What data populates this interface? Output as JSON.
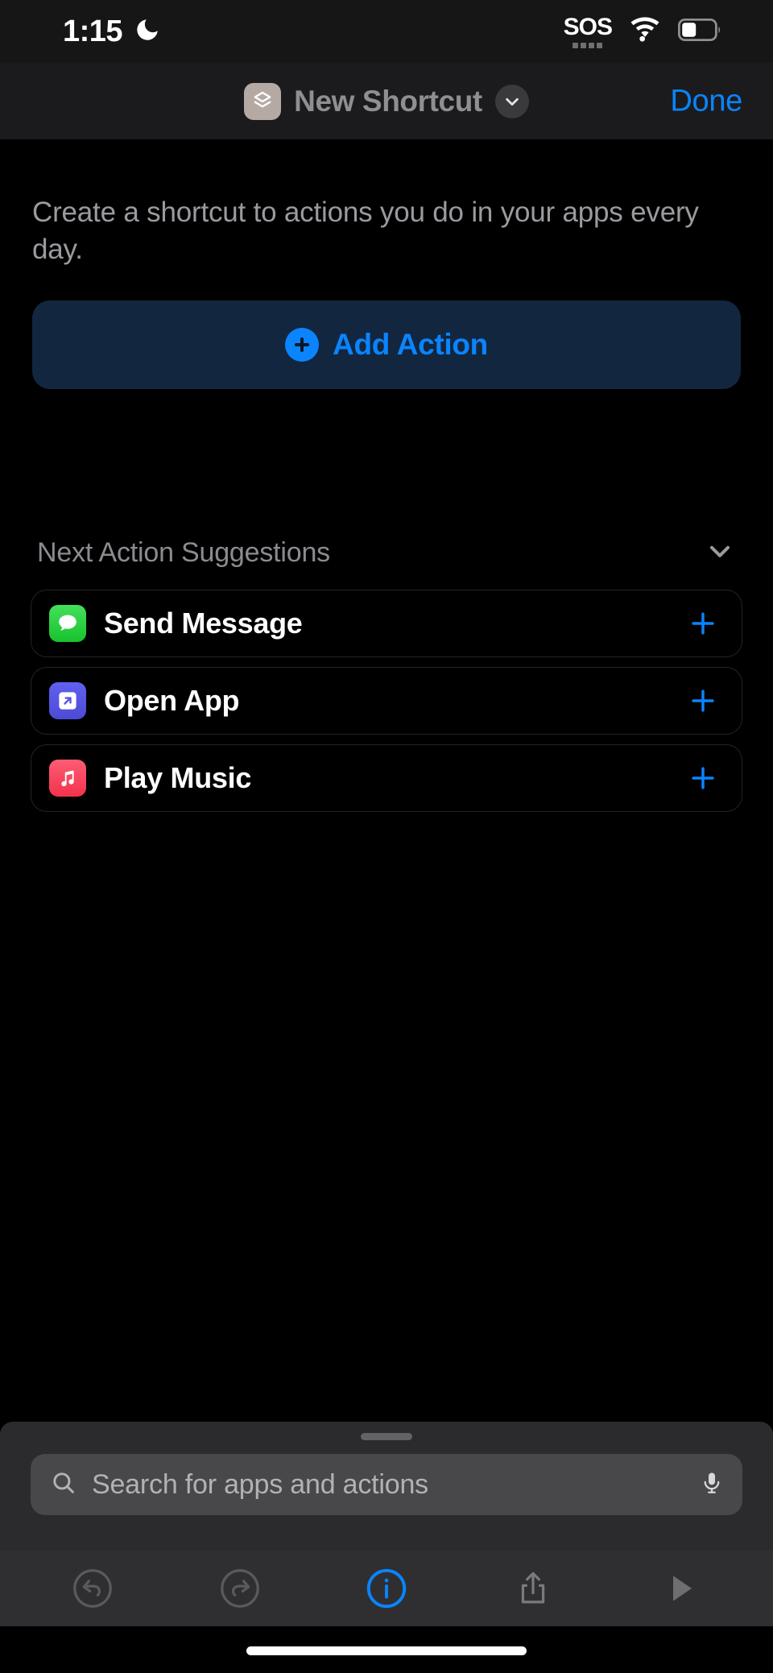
{
  "status_bar": {
    "time": "1:15",
    "dnd_icon": "moon-icon",
    "sos_label": "SOS",
    "wifi_icon": "wifi-icon",
    "battery_icon": "battery-icon"
  },
  "nav_bar": {
    "shortcut_icon": "shortcut-stack-icon",
    "title": "New Shortcut",
    "chevron_icon": "chevron-down-icon",
    "done_label": "Done"
  },
  "main": {
    "description": "Create a shortcut to actions you do in your apps every day.",
    "add_action": {
      "label": "Add Action",
      "plus_icon": "plus-circle-icon",
      "accent_color": "#0A84FF",
      "background_color": "#12263F"
    },
    "suggestions": {
      "title": "Next Action Suggestions",
      "collapse_icon": "chevron-down-icon",
      "items": [
        {
          "label": "Send Message",
          "app_icon": "messages-icon",
          "icon_color": "#2ACC42",
          "add_icon": "plus-icon"
        },
        {
          "label": "Open App",
          "app_icon": "open-app-icon",
          "icon_color": "#5656E6",
          "add_icon": "plus-icon"
        },
        {
          "label": "Play Music",
          "app_icon": "music-icon",
          "icon_color": "#F8435E",
          "add_icon": "plus-icon"
        }
      ]
    }
  },
  "sheet": {
    "grabber": "drag-handle",
    "search": {
      "placeholder": "Search for apps and actions",
      "search_icon": "search-icon",
      "mic_icon": "microphone-icon",
      "value": ""
    }
  },
  "toolbar": {
    "items": [
      {
        "name": "undo-button",
        "icon": "undo-icon",
        "state": "disabled"
      },
      {
        "name": "redo-button",
        "icon": "redo-icon",
        "state": "disabled"
      },
      {
        "name": "info-button",
        "icon": "info-icon",
        "state": "active"
      },
      {
        "name": "share-button",
        "icon": "share-icon",
        "state": "enabled"
      },
      {
        "name": "play-button",
        "icon": "play-icon",
        "state": "enabled"
      }
    ],
    "active_color": "#0A84FF"
  }
}
